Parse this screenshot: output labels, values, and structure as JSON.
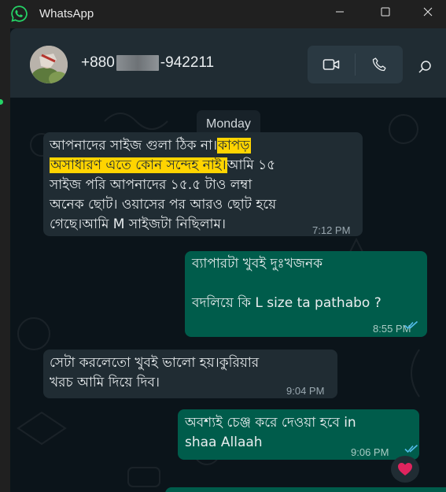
{
  "window": {
    "app_title": "WhatsApp",
    "logo_icon": "whatsapp-logo-icon",
    "controls": [
      "minimize-icon",
      "maximize-icon",
      "close-icon"
    ]
  },
  "header": {
    "contact_prefix": "+880",
    "contact_suffix": "-942211",
    "video_icon": "video-call-icon",
    "voice_icon": "voice-call-icon",
    "search_icon": "search-icon"
  },
  "chat": {
    "date_chip": "Monday",
    "messages": [
      {
        "direction": "incoming",
        "lines": [
          {
            "parts": [
              "আপনাদের সাইজ গুলা ঠিক না।",
              "কাপড়"
            ]
          },
          {
            "parts": [
              "অসাধারণ এতে কোন সন্দেহ নাই।",
              "আমি ১৫"
            ]
          },
          {
            "parts": [
              "সাইজ পরি আপনাদের ১৫.৫ টাও লম্বা"
            ]
          },
          {
            "parts": [
              "অনেক ছোট। ওয়াসের পর আরও ছোট হয়ে"
            ]
          },
          {
            "parts": [
              "গেছে।আমি M সাইজটা নিছিলাম।"
            ]
          }
        ],
        "time": "7:12 PM"
      },
      {
        "direction": "outgoing",
        "line1": "ব্যাপারটা খুবই দুঃখজনক",
        "line2": "বদলিয়ে কি L size ta pathabo ?",
        "time": "8:55 PM",
        "status_icon": "double-check-read-icon"
      },
      {
        "direction": "incoming",
        "line1": "সেটা করলেতো খুবই ভালো হয়।কুরিয়ার",
        "line2": "খরচ আমি দিয়ে দিব।",
        "time": "9:04 PM"
      },
      {
        "direction": "outgoing",
        "line1": "অবশ্যই চেঞ্জ করে দেওয়া হবে in",
        "line2": "shaa Allaah",
        "time": "9:06 PM",
        "status_icon": "double-check-read-icon",
        "reaction_icon": "red-heart-icon"
      }
    ]
  },
  "colors": {
    "chat_bg": "#0b141a",
    "header_bg": "#202c33",
    "incoming_bubble": "#202c33",
    "outgoing_bubble": "#005c4b",
    "highlight": "#ffd400",
    "read_tick": "#53bdeb"
  }
}
